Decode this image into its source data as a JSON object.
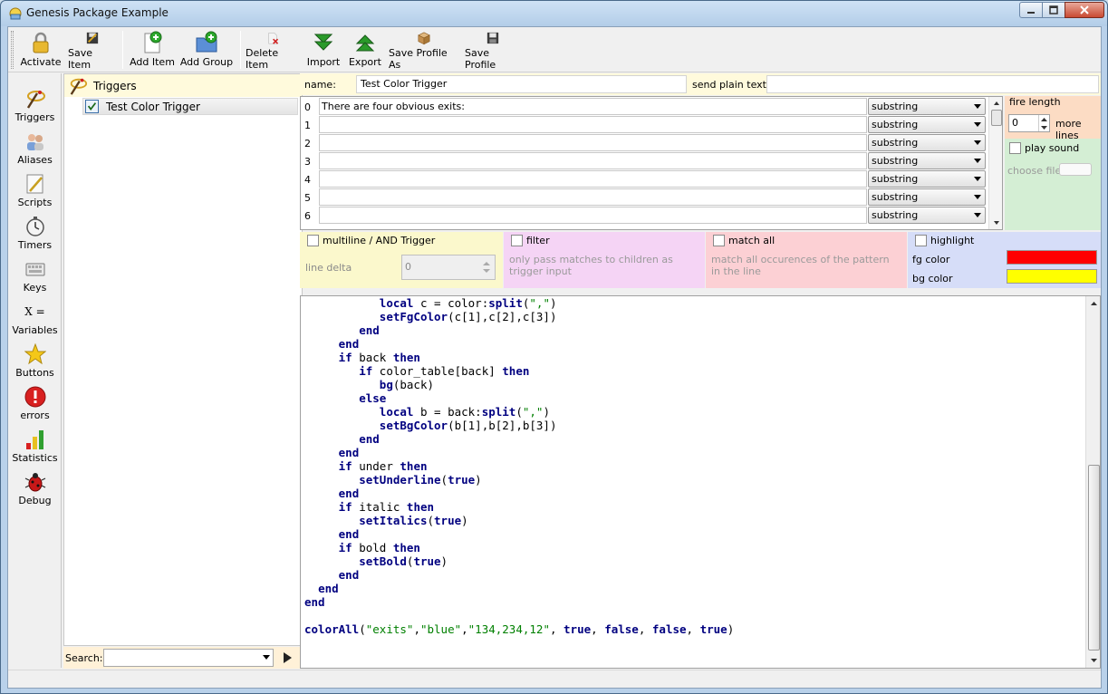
{
  "window": {
    "title": "Genesis Package Example"
  },
  "toolbar": {
    "activate": "Activate",
    "save_item": "Save Item",
    "add_item": "Add Item",
    "add_group": "Add Group",
    "delete_item": "Delete Item",
    "import": "Import",
    "export": "Export",
    "save_profile_as": "Save Profile As",
    "save_profile": "Save Profile"
  },
  "sidebar": {
    "items": [
      {
        "label": "Triggers",
        "icon": "triggers-icon"
      },
      {
        "label": "Aliases",
        "icon": "aliases-icon"
      },
      {
        "label": "Scripts",
        "icon": "scripts-icon"
      },
      {
        "label": "Timers",
        "icon": "timers-icon"
      },
      {
        "label": "Keys",
        "icon": "keys-icon"
      },
      {
        "label": "Variables",
        "icon": "variables-icon"
      },
      {
        "label": "Buttons",
        "icon": "buttons-icon"
      },
      {
        "label": "errors",
        "icon": "errors-icon"
      },
      {
        "label": "Statistics",
        "icon": "statistics-icon"
      },
      {
        "label": "Debug",
        "icon": "debug-icon"
      }
    ],
    "variables_glyph": "X ="
  },
  "tree": {
    "root_label": "Triggers",
    "item_label": "Test Color Trigger"
  },
  "search": {
    "label": "Search:",
    "value": ""
  },
  "trigger": {
    "name_label": "name:",
    "name_value": "Test Color Trigger",
    "plain_label": "send plain text:",
    "plain_value": "",
    "patterns": [
      {
        "num": "0",
        "text": "There are four obvious exits:",
        "type": "substring"
      },
      {
        "num": "1",
        "text": "",
        "type": "substring"
      },
      {
        "num": "2",
        "text": "",
        "type": "substring"
      },
      {
        "num": "3",
        "text": "",
        "type": "substring"
      },
      {
        "num": "4",
        "text": "",
        "type": "substring"
      },
      {
        "num": "5",
        "text": "",
        "type": "substring"
      },
      {
        "num": "6",
        "text": "",
        "type": "substring"
      }
    ]
  },
  "fire": {
    "label": "fire length",
    "value": "0",
    "more": "more lines"
  },
  "sound": {
    "label": "play sound",
    "choose": "choose file:"
  },
  "options": {
    "multiline": "multiline / AND Trigger",
    "line_delta": "line delta",
    "line_delta_value": "0",
    "filter": "filter",
    "filter_desc": "only pass matches to children as trigger input",
    "match_all": "match all",
    "match_all_desc": "match all occurences of the pattern in the line",
    "highlight": "highlight",
    "fg_label": "fg color",
    "bg_label": "bg color",
    "fg_color": "#ff0000",
    "bg_color": "#ffff00"
  }
}
